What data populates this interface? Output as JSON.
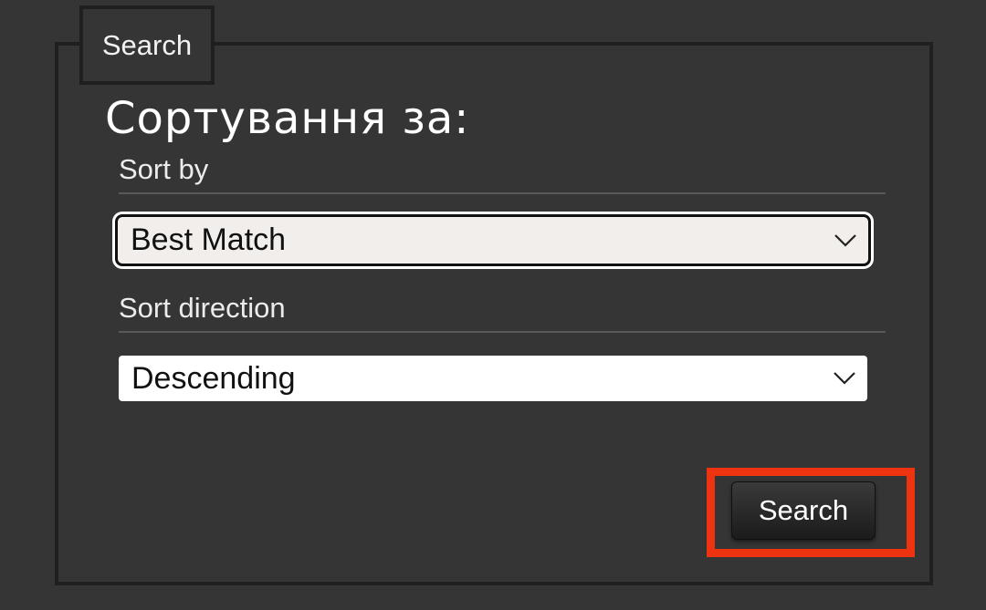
{
  "form": {
    "legend": "Search",
    "heading": "Сортування за:",
    "sort_by": {
      "label": "Sort by",
      "selected": "Best Match",
      "icon": "chevron-down-icon"
    },
    "sort_direction": {
      "label": "Sort direction",
      "selected": "Descending",
      "icon": "chevron-down-icon"
    },
    "submit_label": "Search"
  },
  "colors": {
    "background": "#353535",
    "border": "#1f1f1f",
    "highlight": "#ee3311",
    "select_active_bg": "#f1eeeb",
    "select_bg": "#ffffff"
  }
}
